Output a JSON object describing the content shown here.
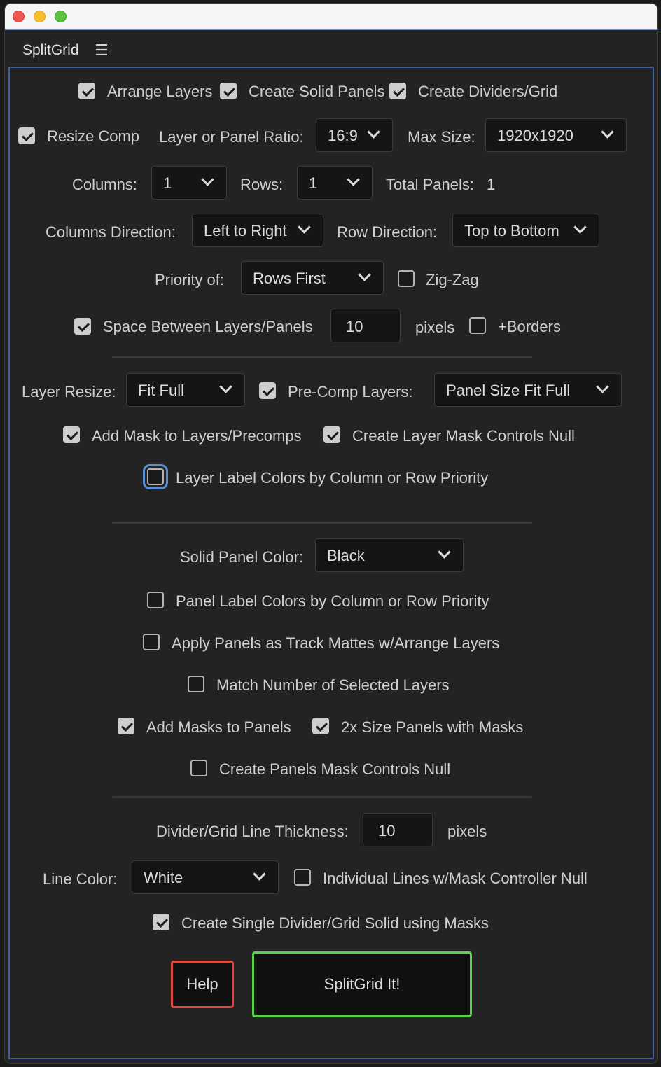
{
  "panel": {
    "title": "SplitGrid",
    "menu_icon": "hamburger-icon"
  },
  "row1": {
    "arrange_layers": "Arrange Layers",
    "create_solid_panels": "Create Solid Panels",
    "create_dividers": "Create Dividers/Grid"
  },
  "row2": {
    "resize_comp": "Resize Comp",
    "ratio_label": "Layer or Panel Ratio:",
    "ratio_value": "16:9",
    "max_size_label": "Max Size:",
    "max_size_value": "1920x1920"
  },
  "row3": {
    "columns_label": "Columns:",
    "columns_value": "1",
    "rows_label": "Rows:",
    "rows_value": "1",
    "total_label": "Total Panels:",
    "total_value": "1"
  },
  "row4": {
    "col_dir_label": "Columns Direction:",
    "col_dir_value": "Left to Right",
    "row_dir_label": "Row Direction:",
    "row_dir_value": "Top to Bottom"
  },
  "row5": {
    "priority_label": "Priority of:",
    "priority_value": "Rows First",
    "zigzag": "Zig-Zag"
  },
  "row6": {
    "space_between": "Space Between Layers/Panels",
    "space_value": "10",
    "pixels": "pixels",
    "borders": "+Borders"
  },
  "row7": {
    "layer_resize_label": "Layer Resize:",
    "layer_resize_value": "Fit Full",
    "precomp": "Pre-Comp Layers:",
    "precomp_value": "Panel Size Fit Full"
  },
  "row8": {
    "add_mask": "Add Mask to Layers/Precomps",
    "mask_controls": "Create Layer Mask Controls Null"
  },
  "row9": {
    "label_colors": "Layer Label Colors by Column or Row Priority"
  },
  "solid": {
    "color_label": "Solid Panel Color:",
    "color_value": "Black",
    "panel_label_colors": "Panel Label Colors by Column or Row Priority",
    "track_mattes": "Apply Panels as Track Mattes w/Arrange Layers",
    "match_number": "Match Number of Selected Layers",
    "add_masks": "Add Masks to Panels",
    "size_2x": "2x Size Panels with Masks",
    "mask_null": "Create Panels Mask Controls Null"
  },
  "divider": {
    "thickness_label": "Divider/Grid Line Thickness:",
    "thickness_value": "10",
    "pixels": "pixels",
    "line_color_label": "Line Color:",
    "line_color_value": "White",
    "individual_lines": "Individual Lines w/Mask Controller Null",
    "single_solid": "Create Single Divider/Grid Solid using Masks"
  },
  "buttons": {
    "help": "Help",
    "run": "SplitGrid It!"
  },
  "colors": {
    "help_border": "#e0493b",
    "run_border": "#58d24a",
    "focus_ring": "#5a8fd8",
    "panel_border": "#3e5e9c"
  }
}
